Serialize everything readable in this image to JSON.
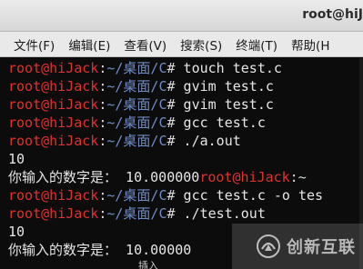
{
  "window": {
    "title": "root@hiJ"
  },
  "menu": [
    {
      "label": "文件(F)"
    },
    {
      "label": "编辑(E)"
    },
    {
      "label": "查看(V)"
    },
    {
      "label": "搜索(S)"
    },
    {
      "label": "终端(T)"
    },
    {
      "label": "帮助(H"
    }
  ],
  "terminal": {
    "prompt_user": "root@hiJack",
    "prompt_sep": ":",
    "prompt_path": "~/桌面/C",
    "prompt_tail": "#",
    "lines": [
      {
        "cmd": " touch test.c"
      },
      {
        "cmd": " gvim test.c"
      },
      {
        "cmd": " gvim test.c"
      },
      {
        "cmd": " gcc test.c"
      },
      {
        "cmd": " ./a.out"
      }
    ],
    "out1": "10",
    "out2_label": "你输入的数字是：",
    "out2_value": " 10.000000",
    "out2_user": "root@hiJack",
    "out2_sep": ":~",
    "line7_cmd": " gcc test.c -o tes",
    "line8_cmd": " ./test.out",
    "out3": "10",
    "out4_label": "你输入的数字是：",
    "out4_value": " 10.00000",
    "popup_text": "插入"
  },
  "watermark": {
    "text": "创新互联"
  }
}
